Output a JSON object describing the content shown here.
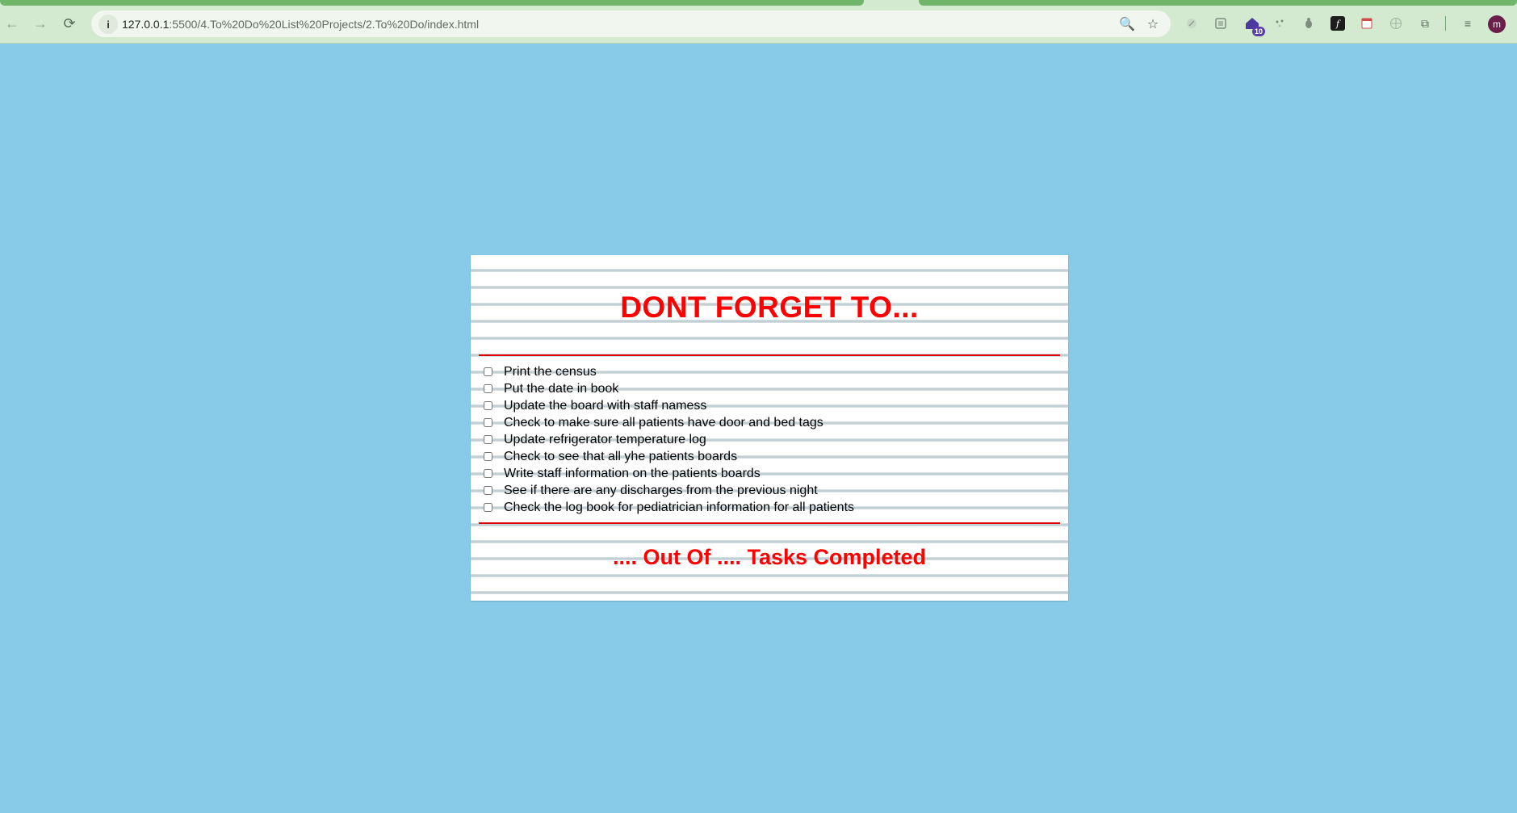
{
  "browser": {
    "url_host": "127.0.0.1",
    "url_rest": ":5500/4.To%20Do%20List%20Projects/2.To%20Do/index.html",
    "site_info_glyph": "i",
    "extension_badge": "10",
    "avatar_initial": "m",
    "icons": {
      "back": "←",
      "forward": "→",
      "reload": "⟳",
      "zoom": "🔍",
      "bookmark": "☆",
      "puzzle": "⧉",
      "media": "≡"
    }
  },
  "card": {
    "title": "DONT FORGET TO...",
    "tasks": [
      {
        "label": "Print the census",
        "checked": false
      },
      {
        "label": "Put the date in book",
        "checked": false
      },
      {
        "label": "Update the board with staff namess",
        "checked": false
      },
      {
        "label": "Check to make sure all patients have door and bed tags",
        "checked": false
      },
      {
        "label": "Update refrigerator temperature log",
        "checked": false
      },
      {
        "label": "Check to see that all yhe patients boards",
        "checked": false
      },
      {
        "label": "Write staff information on the patients boards",
        "checked": false
      },
      {
        "label": "See if there are any discharges from the previous night",
        "checked": false
      },
      {
        "label": "Check the log book for pediatrician information for all patients",
        "checked": false
      }
    ],
    "summary": ".... Out Of .... Tasks Completed"
  },
  "colors": {
    "page_background": "#87cbe8",
    "accent_red": "#ff0000",
    "chrome_background": "#d3ead0"
  }
}
